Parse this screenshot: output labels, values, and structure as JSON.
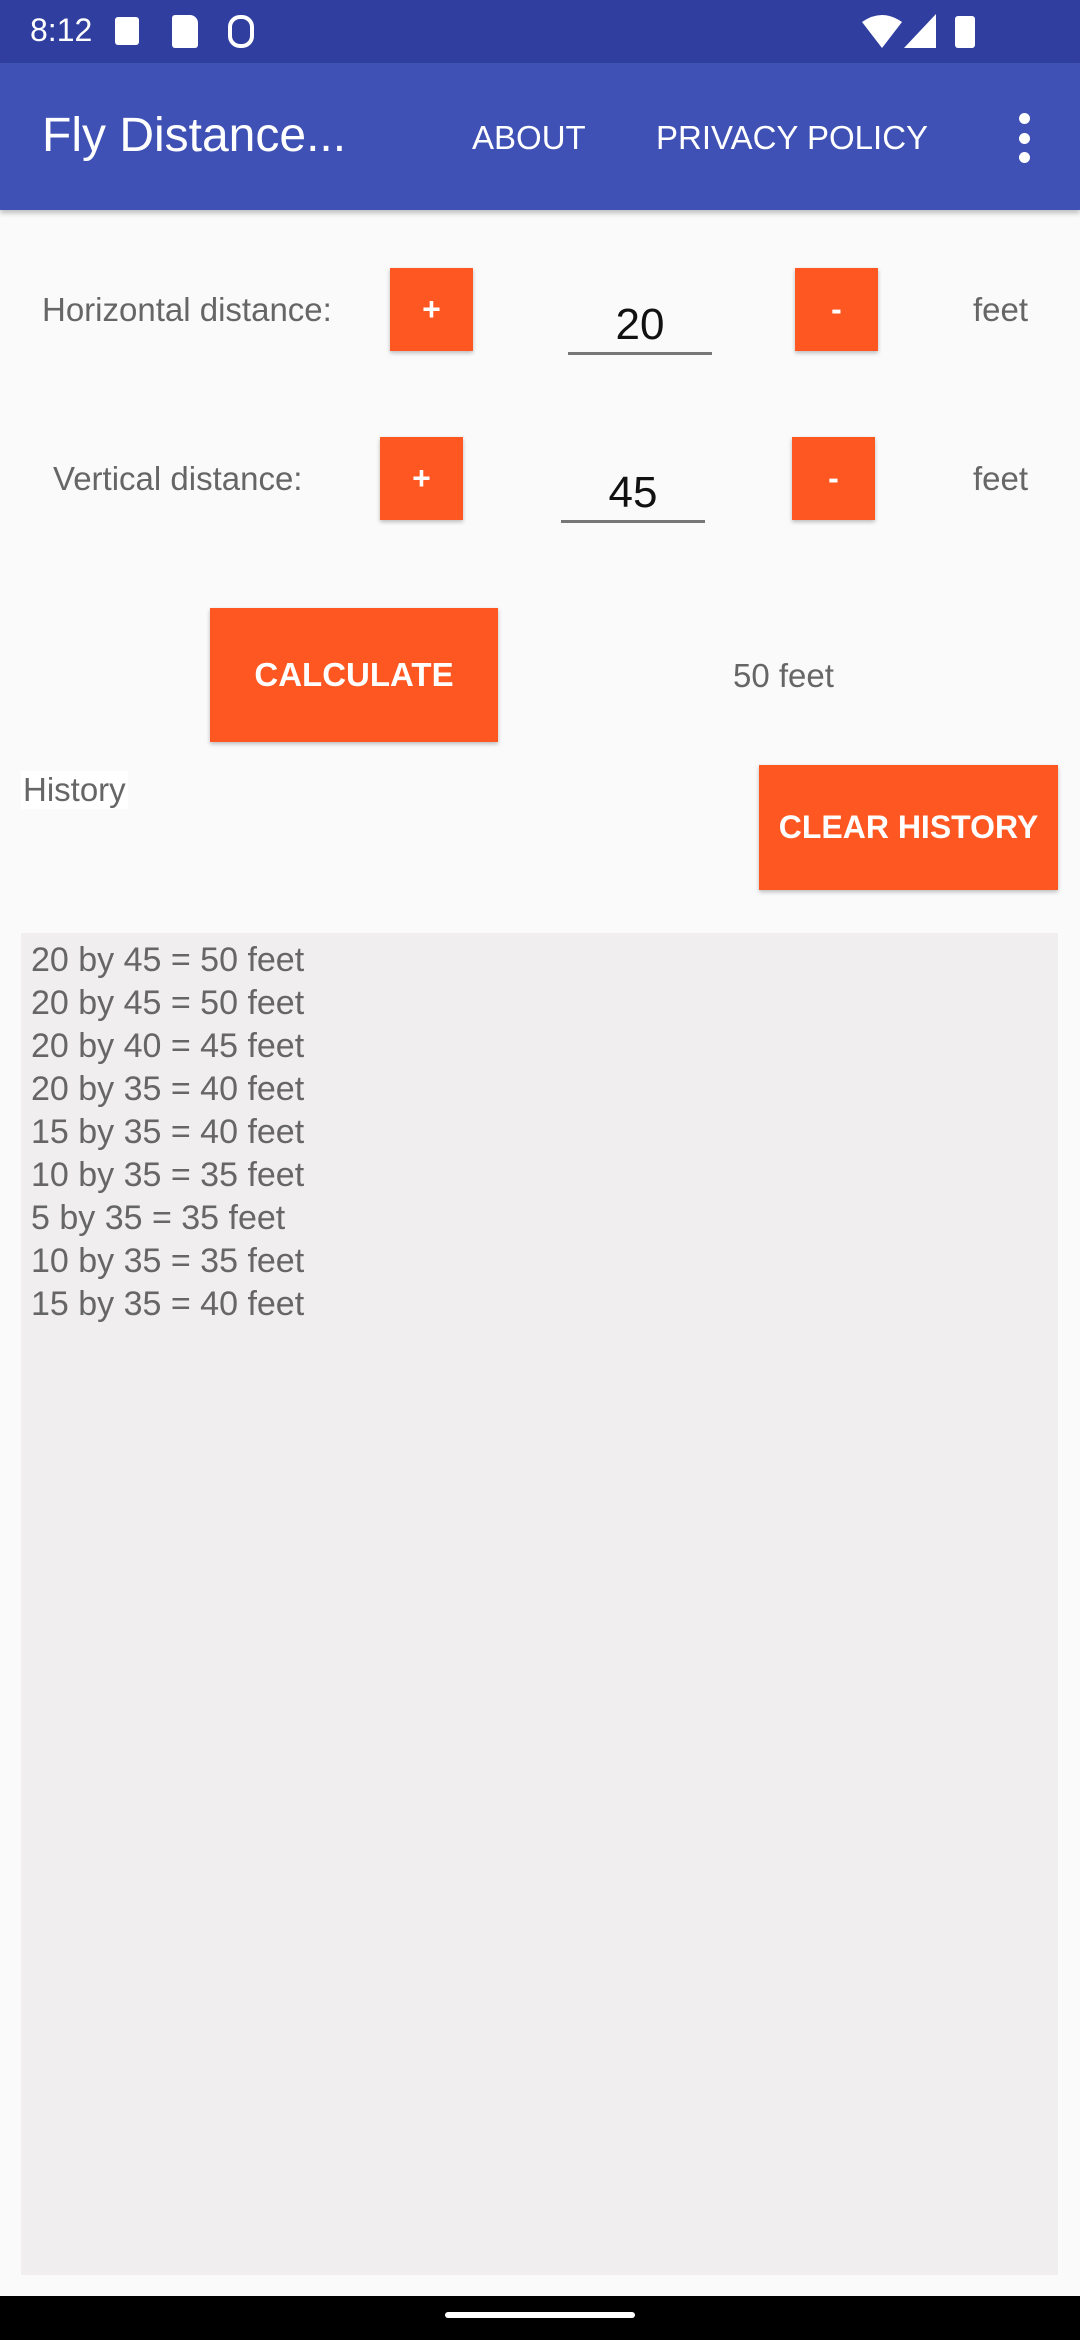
{
  "status_bar": {
    "time": "8:12",
    "left_icons": [
      "a-badge-icon",
      "sd-card-icon",
      "debug-icon"
    ],
    "right_icons": [
      "wifi-icon",
      "signal-icon",
      "battery-icon"
    ]
  },
  "app_bar": {
    "title": "Fly Distance...",
    "about": "ABOUT",
    "privacy": "PRIVACY POLICY",
    "overflow_icon": "more-vert-icon"
  },
  "horizontal": {
    "label": "Horizontal distance:",
    "plus": "+",
    "value": "20",
    "minus": "-",
    "unit": "feet"
  },
  "vertical": {
    "label": "Vertical distance:",
    "plus": "+",
    "value": "45",
    "minus": "-",
    "unit": "feet"
  },
  "calculate_label": "CALCULATE",
  "result": "50 feet",
  "history_label": "History",
  "clear_history_label": "CLEAR HISTORY",
  "history": [
    "20 by 45 = 50 feet",
    "20 by 45 = 50 feet",
    "20 by 40 = 45 feet",
    "20 by 35 = 40 feet",
    "15 by 35 = 40 feet",
    "10 by 35 = 35 feet",
    "5 by 35 = 35 feet",
    "10 by 35 = 35 feet",
    "15 by 35 = 40 feet"
  ],
  "colors": {
    "primary": "#3f51b5",
    "primary_dark": "#303f9f",
    "accent": "#ff5722"
  }
}
